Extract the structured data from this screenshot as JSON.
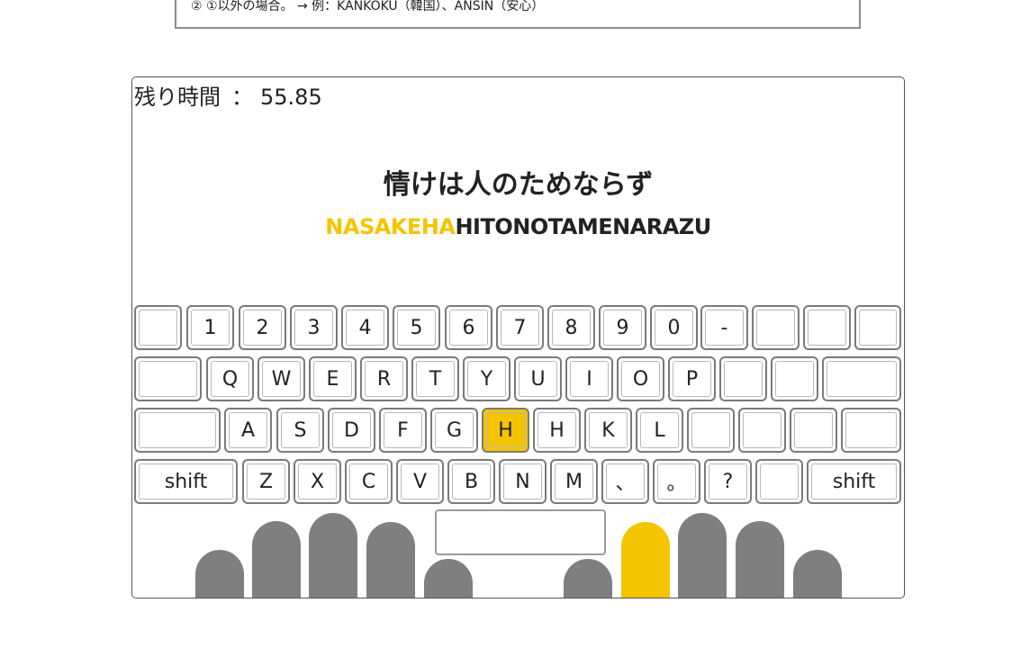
{
  "note": {
    "text": "② ①以外の場合。 → 例：KANKOKU（韓国）、ANSIN（安心）"
  },
  "timer": {
    "label": "残り時間",
    "separator": "：",
    "value": "55.85"
  },
  "phrase": {
    "japanese": "情けは人のためならず",
    "romaji_typed": "NASAKEHA",
    "romaji_remaining": "HITONOTAMENARAZU"
  },
  "keyboard": {
    "row1": [
      "",
      "1",
      "2",
      "3",
      "4",
      "5",
      "6",
      "7",
      "8",
      "9",
      "0",
      "-",
      "",
      "",
      ""
    ],
    "row2": [
      "",
      "Q",
      "W",
      "E",
      "R",
      "T",
      "Y",
      "U",
      "I",
      "O",
      "P",
      "",
      "",
      ""
    ],
    "row3": [
      "",
      "A",
      "S",
      "D",
      "F",
      "G",
      "H",
      "H",
      "K",
      "L",
      "",
      "",
      "",
      ""
    ],
    "row4": [
      "shift",
      "Z",
      "X",
      "C",
      "V",
      "B",
      "N",
      "M",
      "、",
      "。",
      "?",
      "",
      "shift"
    ],
    "highlighted_key": "H"
  },
  "fingers": {
    "active": "right-index"
  },
  "colors": {
    "accent": "#f5c400",
    "finger": "#7f7f7f",
    "border": "#7a7a7a"
  }
}
